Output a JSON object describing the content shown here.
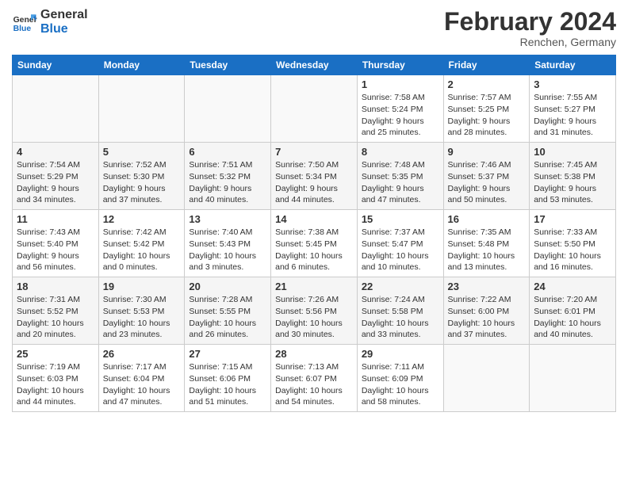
{
  "header": {
    "logo_line1": "General",
    "logo_line2": "Blue",
    "month_title": "February 2024",
    "location": "Renchen, Germany"
  },
  "weekdays": [
    "Sunday",
    "Monday",
    "Tuesday",
    "Wednesday",
    "Thursday",
    "Friday",
    "Saturday"
  ],
  "weeks": [
    [
      {
        "day": "",
        "sunrise": "",
        "sunset": "",
        "daylight": ""
      },
      {
        "day": "",
        "sunrise": "",
        "sunset": "",
        "daylight": ""
      },
      {
        "day": "",
        "sunrise": "",
        "sunset": "",
        "daylight": ""
      },
      {
        "day": "",
        "sunrise": "",
        "sunset": "",
        "daylight": ""
      },
      {
        "day": "1",
        "sunrise": "Sunrise: 7:58 AM",
        "sunset": "Sunset: 5:24 PM",
        "daylight": "Daylight: 9 hours and 25 minutes."
      },
      {
        "day": "2",
        "sunrise": "Sunrise: 7:57 AM",
        "sunset": "Sunset: 5:25 PM",
        "daylight": "Daylight: 9 hours and 28 minutes."
      },
      {
        "day": "3",
        "sunrise": "Sunrise: 7:55 AM",
        "sunset": "Sunset: 5:27 PM",
        "daylight": "Daylight: 9 hours and 31 minutes."
      }
    ],
    [
      {
        "day": "4",
        "sunrise": "Sunrise: 7:54 AM",
        "sunset": "Sunset: 5:29 PM",
        "daylight": "Daylight: 9 hours and 34 minutes."
      },
      {
        "day": "5",
        "sunrise": "Sunrise: 7:52 AM",
        "sunset": "Sunset: 5:30 PM",
        "daylight": "Daylight: 9 hours and 37 minutes."
      },
      {
        "day": "6",
        "sunrise": "Sunrise: 7:51 AM",
        "sunset": "Sunset: 5:32 PM",
        "daylight": "Daylight: 9 hours and 40 minutes."
      },
      {
        "day": "7",
        "sunrise": "Sunrise: 7:50 AM",
        "sunset": "Sunset: 5:34 PM",
        "daylight": "Daylight: 9 hours and 44 minutes."
      },
      {
        "day": "8",
        "sunrise": "Sunrise: 7:48 AM",
        "sunset": "Sunset: 5:35 PM",
        "daylight": "Daylight: 9 hours and 47 minutes."
      },
      {
        "day": "9",
        "sunrise": "Sunrise: 7:46 AM",
        "sunset": "Sunset: 5:37 PM",
        "daylight": "Daylight: 9 hours and 50 minutes."
      },
      {
        "day": "10",
        "sunrise": "Sunrise: 7:45 AM",
        "sunset": "Sunset: 5:38 PM",
        "daylight": "Daylight: 9 hours and 53 minutes."
      }
    ],
    [
      {
        "day": "11",
        "sunrise": "Sunrise: 7:43 AM",
        "sunset": "Sunset: 5:40 PM",
        "daylight": "Daylight: 9 hours and 56 minutes."
      },
      {
        "day": "12",
        "sunrise": "Sunrise: 7:42 AM",
        "sunset": "Sunset: 5:42 PM",
        "daylight": "Daylight: 10 hours and 0 minutes."
      },
      {
        "day": "13",
        "sunrise": "Sunrise: 7:40 AM",
        "sunset": "Sunset: 5:43 PM",
        "daylight": "Daylight: 10 hours and 3 minutes."
      },
      {
        "day": "14",
        "sunrise": "Sunrise: 7:38 AM",
        "sunset": "Sunset: 5:45 PM",
        "daylight": "Daylight: 10 hours and 6 minutes."
      },
      {
        "day": "15",
        "sunrise": "Sunrise: 7:37 AM",
        "sunset": "Sunset: 5:47 PM",
        "daylight": "Daylight: 10 hours and 10 minutes."
      },
      {
        "day": "16",
        "sunrise": "Sunrise: 7:35 AM",
        "sunset": "Sunset: 5:48 PM",
        "daylight": "Daylight: 10 hours and 13 minutes."
      },
      {
        "day": "17",
        "sunrise": "Sunrise: 7:33 AM",
        "sunset": "Sunset: 5:50 PM",
        "daylight": "Daylight: 10 hours and 16 minutes."
      }
    ],
    [
      {
        "day": "18",
        "sunrise": "Sunrise: 7:31 AM",
        "sunset": "Sunset: 5:52 PM",
        "daylight": "Daylight: 10 hours and 20 minutes."
      },
      {
        "day": "19",
        "sunrise": "Sunrise: 7:30 AM",
        "sunset": "Sunset: 5:53 PM",
        "daylight": "Daylight: 10 hours and 23 minutes."
      },
      {
        "day": "20",
        "sunrise": "Sunrise: 7:28 AM",
        "sunset": "Sunset: 5:55 PM",
        "daylight": "Daylight: 10 hours and 26 minutes."
      },
      {
        "day": "21",
        "sunrise": "Sunrise: 7:26 AM",
        "sunset": "Sunset: 5:56 PM",
        "daylight": "Daylight: 10 hours and 30 minutes."
      },
      {
        "day": "22",
        "sunrise": "Sunrise: 7:24 AM",
        "sunset": "Sunset: 5:58 PM",
        "daylight": "Daylight: 10 hours and 33 minutes."
      },
      {
        "day": "23",
        "sunrise": "Sunrise: 7:22 AM",
        "sunset": "Sunset: 6:00 PM",
        "daylight": "Daylight: 10 hours and 37 minutes."
      },
      {
        "day": "24",
        "sunrise": "Sunrise: 7:20 AM",
        "sunset": "Sunset: 6:01 PM",
        "daylight": "Daylight: 10 hours and 40 minutes."
      }
    ],
    [
      {
        "day": "25",
        "sunrise": "Sunrise: 7:19 AM",
        "sunset": "Sunset: 6:03 PM",
        "daylight": "Daylight: 10 hours and 44 minutes."
      },
      {
        "day": "26",
        "sunrise": "Sunrise: 7:17 AM",
        "sunset": "Sunset: 6:04 PM",
        "daylight": "Daylight: 10 hours and 47 minutes."
      },
      {
        "day": "27",
        "sunrise": "Sunrise: 7:15 AM",
        "sunset": "Sunset: 6:06 PM",
        "daylight": "Daylight: 10 hours and 51 minutes."
      },
      {
        "day": "28",
        "sunrise": "Sunrise: 7:13 AM",
        "sunset": "Sunset: 6:07 PM",
        "daylight": "Daylight: 10 hours and 54 minutes."
      },
      {
        "day": "29",
        "sunrise": "Sunrise: 7:11 AM",
        "sunset": "Sunset: 6:09 PM",
        "daylight": "Daylight: 10 hours and 58 minutes."
      },
      {
        "day": "",
        "sunrise": "",
        "sunset": "",
        "daylight": ""
      },
      {
        "day": "",
        "sunrise": "",
        "sunset": "",
        "daylight": ""
      }
    ]
  ]
}
